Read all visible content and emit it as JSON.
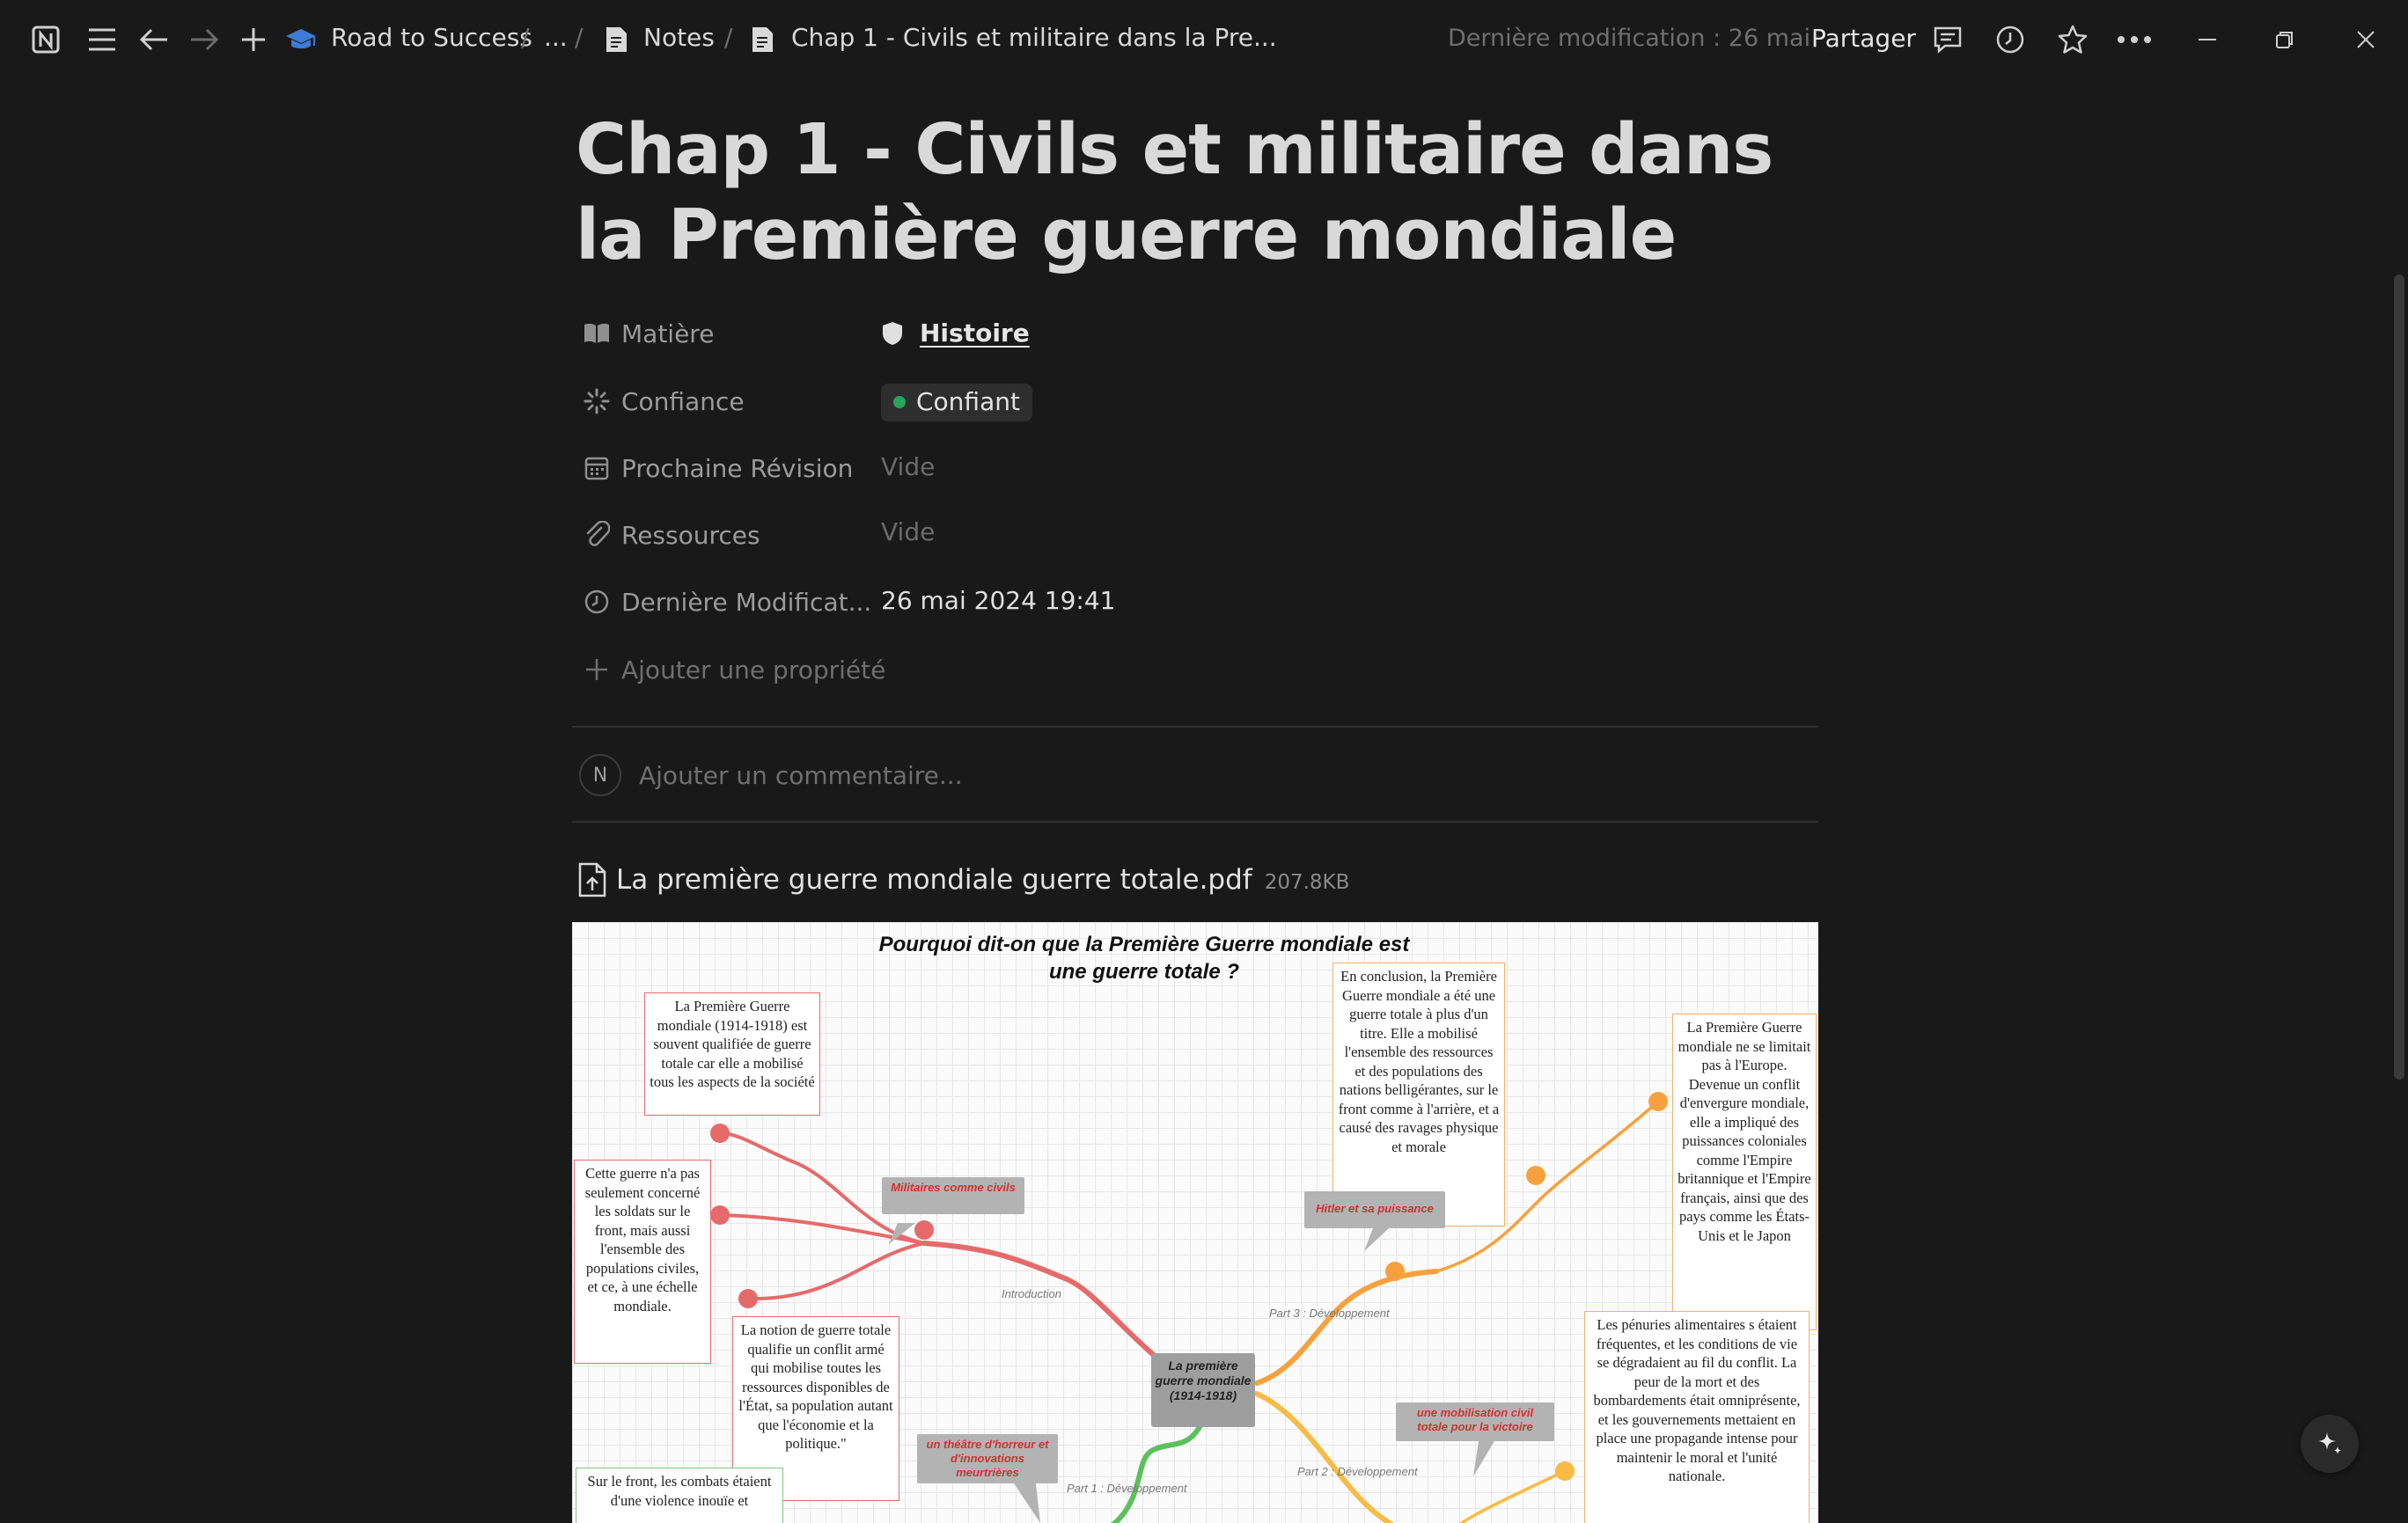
{
  "topbar": {
    "workspace": "Road to Success",
    "ellipsis": "...",
    "separator": "/",
    "notes": "Notes",
    "current": "Chap 1 - Civils et militaire dans la Pre...",
    "last_modified": "Dernière modification : 26 mai",
    "share": "Partager"
  },
  "page": {
    "title": "Chap 1 - Civils et militaire dans la Première guerre mondiale",
    "properties": [
      {
        "label": "Matière",
        "value": "Histoire",
        "icon": "book-icon"
      },
      {
        "label": "Confiance",
        "value": "Confiant",
        "icon": "loader-icon",
        "status_color": "#27a35b"
      },
      {
        "label": "Prochaine Révision",
        "value": "Vide",
        "icon": "calendar-icon"
      },
      {
        "label": "Ressources",
        "value": "Vide",
        "icon": "paperclip-icon"
      },
      {
        "label": "Dernière Modificat...",
        "value": "26 mai 2024 19:41",
        "icon": "clock-icon"
      }
    ],
    "add_property": "Ajouter une propriété",
    "comment_avatar": "N",
    "comment_placeholder": "Ajouter un commentaire...",
    "file": {
      "name": "La première guerre mondiale guerre totale.pdf",
      "size": "207.8KB"
    }
  },
  "pdf": {
    "title": "Pourquoi dit-on que la Première Guerre mondiale est une guerre totale ?",
    "center": "La première guerre mondiale (1914-1918)",
    "boxes": {
      "intro1": "La Première Guerre mondiale (1914-1918) est souvent qualifiée de guerre totale car elle a mobilisé tous les aspects de la société",
      "intro2": "Cette guerre n'a pas seulement concerné les soldats sur le front, mais aussi l'ensemble des populations civiles, et ce, à une échelle mondiale.",
      "intro3": "La notion de guerre totale qualifie un conflit armé qui mobilise toutes les ressources disponibles de l'État, sa population autant que l'économie et la politique.\"",
      "conclusion": "En conclusion, la Première Guerre mondiale a été une guerre totale à plus d'un titre. Elle a mobilisé l'ensemble des ressources et des populations des nations belligérantes, sur le front comme à l'arrière, et a causé des ravages physique et morale",
      "world": "La Première Guerre mondiale ne se limitait pas à l'Europe. Devenue un conflit d'envergure mondiale, elle a impliqué des puissances coloniales comme l'Empire britannique et l'Empire français, ainsi que des pays comme les États-Unis et le Japon",
      "penuries": "Les pénuries alimentaires s étaient fréquentes, et les conditions de vie se dégradaient au fil du conflit. La peur de la mort et des bombardements était omniprésente, et les gouvernements mettaient en place une propagande intense pour maintenir le moral et l'unité nationale.",
      "front": "Sur le front, les combats étaient d'une violence inouïe et"
    },
    "tags": {
      "militaires": "Militaires comme civils",
      "hitler": "Hitler et sa puissance",
      "mobilisation": "une mobilisation civil totale pour la victoire",
      "theatre": "un théâtre d'horreur et d'innovations meurtrières"
    },
    "parts": {
      "intro": "Introduction",
      "part3": "Part 3 : Développement",
      "part2": "Part 2 : Développement",
      "part1": "Part 1 : Développement"
    },
    "colors": {
      "red": "#e66a6a",
      "orange": "#f7a13e",
      "yellow": "#f8bb45",
      "green": "#5cc15c"
    }
  }
}
